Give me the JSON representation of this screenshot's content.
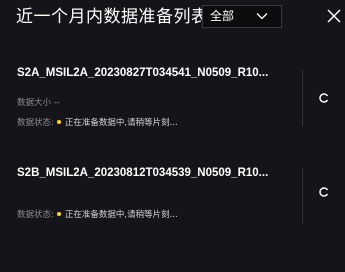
{
  "header": {
    "title": "近一个月内数据准备列表",
    "filter": {
      "selected": "全部",
      "icon": "chevron-down-icon"
    },
    "close_icon": "close-icon"
  },
  "items": [
    {
      "name": "S2A_MSIL2A_20230827T034541_N0509_R10...",
      "size_label": "数据大小",
      "size_value": "--",
      "status_label": "数据状态:",
      "status_text": "正在准备数据中,请稍等片刻...",
      "status_color": "#ffd21f",
      "action_icon": "refresh-icon"
    },
    {
      "name": "S2B_MSIL2A_20230812T034539_N0509_R10...",
      "status_label": "数据状态:",
      "status_text": "正在准备数据中,请稍等片刻...",
      "status_color": "#ffd21f",
      "action_icon": "refresh-icon"
    }
  ]
}
